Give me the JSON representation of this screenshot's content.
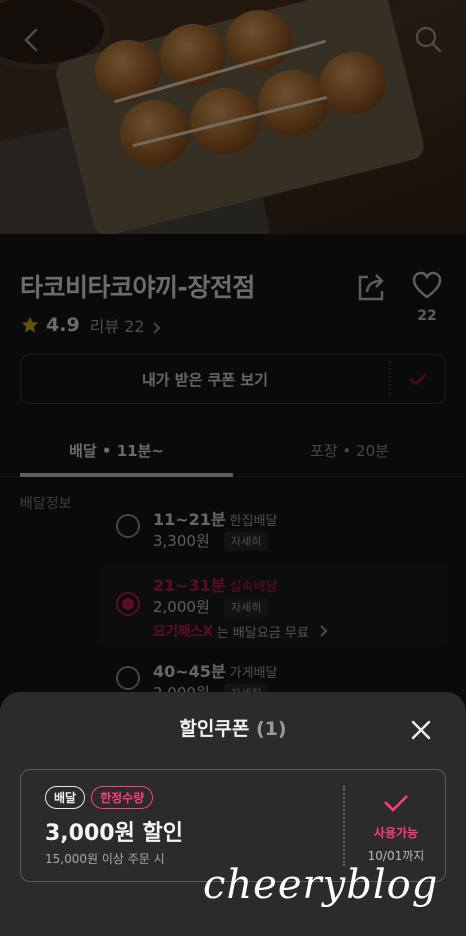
{
  "store": {
    "name": "타코비타코야끼-장전점",
    "rating": "4.9",
    "review_label": "리뷰 22",
    "likes": "22"
  },
  "coupon_view": {
    "label": "내가 받은 쿠폰 보기"
  },
  "tabs": [
    {
      "label": "배달  •  11분~",
      "active": true
    },
    {
      "label": "포장  •  20분",
      "active": false
    }
  ],
  "delivery": {
    "section_label": "배달정보",
    "options": [
      {
        "time": "11~21분",
        "kind": "한집배달",
        "price": "3,300원",
        "detail": "자세히",
        "selected": false
      },
      {
        "time": "21~31분",
        "kind": "실속배달",
        "price": "2,000원",
        "detail": "자세히",
        "selected": true,
        "promo_brand": "요기패스X",
        "promo_text": "는 배달요금 무료"
      },
      {
        "time": "40~45분",
        "kind": "가게배달",
        "price": "2,000원",
        "detail": "자세히",
        "selected": false
      }
    ]
  },
  "sheet": {
    "title": "할인쿠폰",
    "count": "(1)",
    "coupon": {
      "badge_type": "배달",
      "badge_limit": "한정수량",
      "amount": "3,000원 할인",
      "condition": "15,000원 이상 주문 시",
      "status": "사용가능",
      "expiry": "10/01까지"
    }
  },
  "watermark": "cheeryblog",
  "colors": {
    "accent": "#ff3d78",
    "accent_dim": "#b51a4c",
    "sheet_bg": "#2b2b2b"
  },
  "icons": [
    "back-arrow-icon",
    "search-icon",
    "star-icon",
    "chevron-right-icon",
    "share-icon",
    "heart-icon",
    "check-icon",
    "close-icon"
  ]
}
